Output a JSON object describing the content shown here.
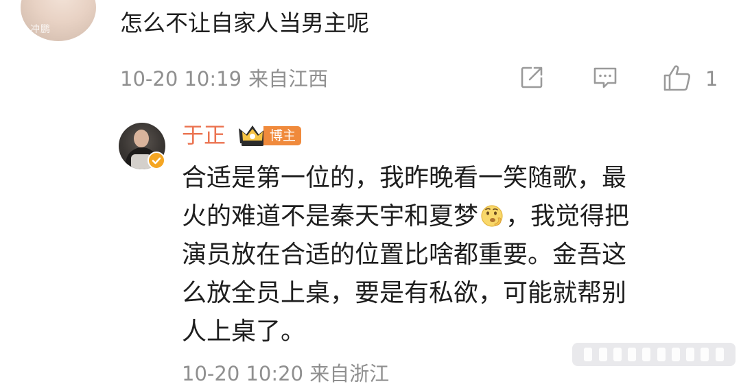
{
  "top_comment": {
    "avatar_caption": "冲鹏",
    "text": "怎么不让自家人当男主呢",
    "time": "10-20 10:19",
    "location": "来自江西",
    "like_count": "1"
  },
  "reply": {
    "author": "于正",
    "badge_label": "博主",
    "lines": [
      "合适是第一位的，我昨晚看一笑随歌，最",
      "火的难道不是秦天宇和夏梦",
      "，我觉得把",
      "演员放在合适的位置比啥都重要。金吾这",
      "么放全员上桌，要是有私欲，可能就帮别",
      "人上桌了。"
    ],
    "cut_meta": "10-20 10:20 来自浙江"
  },
  "icons": {
    "share": "share-icon",
    "comment": "comment-icon",
    "like": "thumbs-up-icon",
    "crown": "crown-icon",
    "verified": "verified-icon",
    "emoji": "thinking-emoji-icon"
  },
  "colors": {
    "author_name": "#eb7350",
    "badge_bg": "#f08a3c",
    "meta_gray": "#8f8f8f",
    "verified": "#f5a623"
  }
}
